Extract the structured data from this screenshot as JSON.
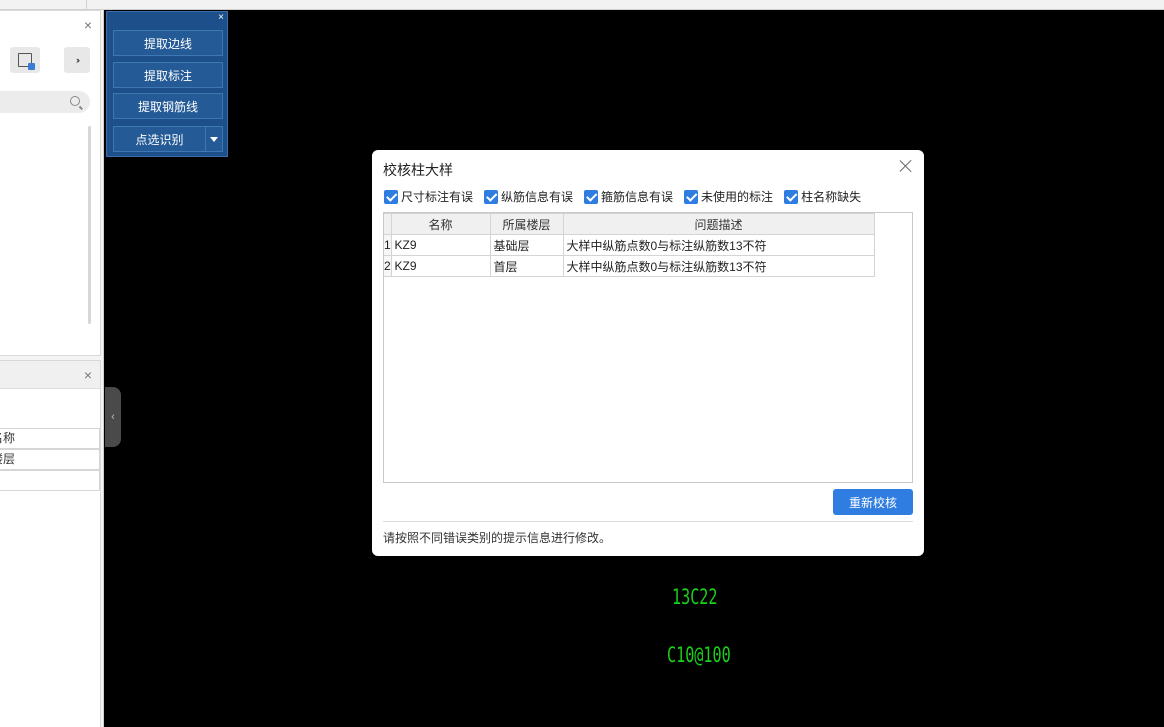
{
  "left_panel_top": {
    "close_label": "×",
    "icon_button": "layer-manage-icon",
    "more_label": "››"
  },
  "left_panel_bottom": {
    "close_label": "×",
    "rows": [
      "名称",
      "楼层",
      ""
    ]
  },
  "tool_panel": {
    "close_label": "×",
    "buttons": [
      "提取边线",
      "提取标注",
      "提取钢筋线"
    ],
    "split_button": "点选识别"
  },
  "collapse_handle_label": "‹",
  "cad_texts": [
    "13C22",
    "C10@100"
  ],
  "dialog": {
    "title": "校核柱大样",
    "filters": [
      {
        "label": "尺寸标注有误",
        "checked": true
      },
      {
        "label": "纵筋信息有误",
        "checked": true
      },
      {
        "label": "箍筋信息有误",
        "checked": true
      },
      {
        "label": "未使用的标注",
        "checked": true
      },
      {
        "label": "柱名称缺失",
        "checked": true
      }
    ],
    "table": {
      "headers": [
        "",
        "名称",
        "所属楼层",
        "问题描述"
      ],
      "rows": [
        {
          "index": "1",
          "name": "KZ9",
          "floor": "基础层",
          "desc": "大样中纵筋点数0与标注纵筋数13不符"
        },
        {
          "index": "2",
          "name": "KZ9",
          "floor": "首层",
          "desc": "大样中纵筋点数0与标注纵筋数13不符"
        }
      ]
    },
    "recheck_button": "重新校核",
    "hint": "请按照不同错误类别的提示信息进行修改。"
  },
  "colors": {
    "accent": "#2f7de1",
    "tool_panel_bg": "#1d4f8a",
    "cad_text": "#19d119",
    "canvas_bg": "#000000"
  }
}
